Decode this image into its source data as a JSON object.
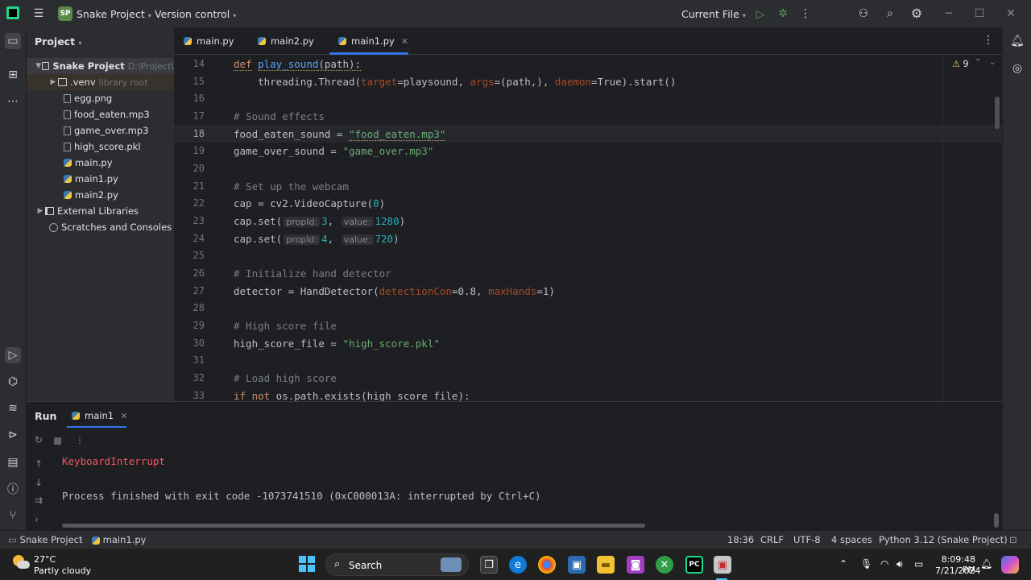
{
  "titlebar": {
    "project_badge": "SP",
    "project_name": "Snake Project",
    "vcs_menu": "Version control",
    "run_config": "Current File"
  },
  "project_panel": {
    "header": "Project",
    "tree": [
      {
        "label": "Snake Project",
        "hint": "D:\\Project\\",
        "type": "folder",
        "expanded": true
      },
      {
        "label": ".venv",
        "hint": "library root",
        "type": "folder",
        "expanded": false
      },
      {
        "label": "egg.png",
        "hint": "",
        "type": "file"
      },
      {
        "label": "food_eaten.mp3",
        "hint": "",
        "type": "file"
      },
      {
        "label": "game_over.mp3",
        "hint": "",
        "type": "file"
      },
      {
        "label": "high_score.pkl",
        "hint": "",
        "type": "file"
      },
      {
        "label": "main.py",
        "hint": "",
        "type": "py"
      },
      {
        "label": "main1.py",
        "hint": "",
        "type": "py"
      },
      {
        "label": "main2.py",
        "hint": "",
        "type": "py"
      },
      {
        "label": "External Libraries",
        "hint": "",
        "type": "lib"
      },
      {
        "label": "Scratches and Consoles",
        "hint": "",
        "type": "scratch"
      }
    ]
  },
  "editor": {
    "tabs": [
      {
        "label": "main.py",
        "active": false
      },
      {
        "label": "main2.py",
        "active": false
      },
      {
        "label": "main1.py",
        "active": true
      }
    ],
    "warning_count": "9",
    "current_line": 18,
    "line_numbers": [
      "14",
      "15",
      "16",
      "17",
      "18",
      "19",
      "20",
      "21",
      "22",
      "23",
      "24",
      "25",
      "26",
      "27",
      "28",
      "29",
      "30",
      "31",
      "32",
      "33"
    ],
    "inlay": {
      "propid": "propId:",
      "value": "value:"
    },
    "code": {
      "l14_def": "def",
      "l14_fn": "play_sound",
      "l14_rest": "(path):",
      "l15_a": "    threading.Thread(",
      "l15_target": "target",
      "l15_b": "=playsound, ",
      "l15_args": "args",
      "l15_c": "=(path,), ",
      "l15_daemon": "daemon",
      "l15_d": "=True).start()",
      "l17": "# Sound effects",
      "l18_a": "food_eaten_sound = ",
      "l18_str": "\"food_eaten.mp3\"",
      "l19_a": "game_over_sound = ",
      "l19_str": "\"game_over.mp3\"",
      "l21": "# Set up the webcam",
      "l22_a": "cap = cv2.VideoCapture(",
      "l22_num": "0",
      "l22_b": ")",
      "l23_a": "cap.set(",
      "l23_n1": "3",
      "l23_n2": "1280",
      "l24_a": "cap.set(",
      "l24_n1": "4",
      "l24_n2": "720",
      "comma": ",",
      "close_paren": ")",
      "l26": "# Initialize hand detector",
      "l27_a": "detector = HandDetector(",
      "l27_p1": "detectionCon",
      "l27_b": "=0.8, ",
      "l27_p2": "maxHands",
      "l27_c": "=1)",
      "l29": "# High score file",
      "l30_a": "high_score_file = ",
      "l30_str": "\"high_score.pkl\"",
      "l32": "# Load high score",
      "l33_if": "if not",
      "l33_rest": " os.path.exists(high_score_file):"
    }
  },
  "run_panel": {
    "title": "Run",
    "tab": "main1",
    "error_line": "KeyboardInterrupt",
    "exit_line": "Process finished with exit code -1073741510 (0xC000013A: interrupted by Ctrl+C)"
  },
  "statusbar": {
    "project": "Snake Project",
    "file": "main1.py",
    "position": "18:36",
    "line_sep": "CRLF",
    "encoding": "UTF-8",
    "indent": "4 spaces",
    "interpreter": "Python 3.12 (Snake Project)"
  },
  "taskbar": {
    "temperature": "27°C",
    "weather": "Partly cloudy",
    "search_label": "Search",
    "time": "8:09:48 PM",
    "date": "7/21/2024"
  }
}
